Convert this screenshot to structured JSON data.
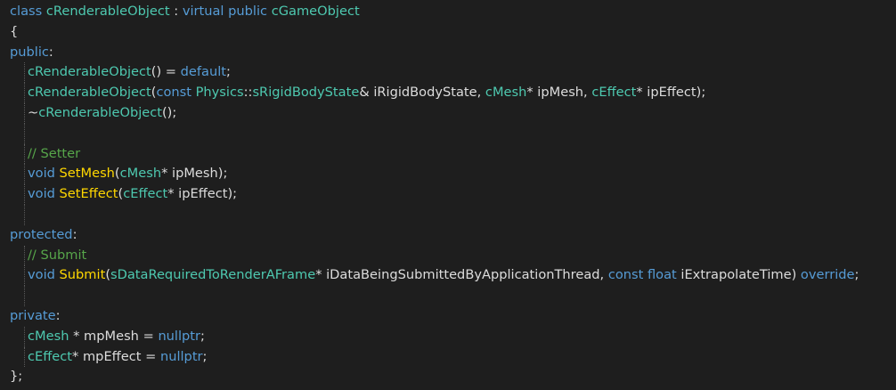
{
  "editor": {
    "colors": {
      "background": "#1e1e1e",
      "keyword": "#569cd6",
      "type": "#4ec9b0",
      "function": "#ffd700",
      "comment": "#57a64a",
      "text": "#dcdcdc"
    },
    "lines": [
      {
        "indent": false,
        "tokens": [
          {
            "t": "class ",
            "c": "kw"
          },
          {
            "t": "cRenderableObject",
            "c": "ty"
          },
          {
            "t": " : ",
            "c": "pl"
          },
          {
            "t": "virtual public ",
            "c": "kw"
          },
          {
            "t": "cGameObject",
            "c": "ty"
          }
        ]
      },
      {
        "indent": false,
        "tokens": [
          {
            "t": "{",
            "c": "pl"
          }
        ]
      },
      {
        "indent": false,
        "tokens": [
          {
            "t": "public",
            "c": "kw"
          },
          {
            "t": ":",
            "c": "pl"
          }
        ]
      },
      {
        "indent": true,
        "tokens": [
          {
            "t": "cRenderableObject",
            "c": "ty"
          },
          {
            "t": "() = ",
            "c": "pl"
          },
          {
            "t": "default",
            "c": "kw"
          },
          {
            "t": ";",
            "c": "pl"
          }
        ]
      },
      {
        "indent": true,
        "tokens": [
          {
            "t": "cRenderableObject",
            "c": "ty"
          },
          {
            "t": "(",
            "c": "pl"
          },
          {
            "t": "const ",
            "c": "kw"
          },
          {
            "t": "Physics",
            "c": "ty"
          },
          {
            "t": "::",
            "c": "pl"
          },
          {
            "t": "sRigidBodyState",
            "c": "ty"
          },
          {
            "t": "& iRigidBodyState, ",
            "c": "pl"
          },
          {
            "t": "cMesh",
            "c": "ty"
          },
          {
            "t": "* ipMesh, ",
            "c": "pl"
          },
          {
            "t": "cEffect",
            "c": "ty"
          },
          {
            "t": "* ipEffect);",
            "c": "pl"
          }
        ]
      },
      {
        "indent": true,
        "tokens": [
          {
            "t": "~",
            "c": "pl"
          },
          {
            "t": "cRenderableObject",
            "c": "ty"
          },
          {
            "t": "();",
            "c": "pl"
          }
        ]
      },
      {
        "indent": true,
        "tokens": []
      },
      {
        "indent": true,
        "tokens": [
          {
            "t": "// Setter",
            "c": "cm"
          }
        ]
      },
      {
        "indent": true,
        "tokens": [
          {
            "t": "void ",
            "c": "kw"
          },
          {
            "t": "SetMesh",
            "c": "fn"
          },
          {
            "t": "(",
            "c": "pl"
          },
          {
            "t": "cMesh",
            "c": "ty"
          },
          {
            "t": "* ipMesh);",
            "c": "pl"
          }
        ]
      },
      {
        "indent": true,
        "tokens": [
          {
            "t": "void ",
            "c": "kw"
          },
          {
            "t": "SetEffect",
            "c": "fn"
          },
          {
            "t": "(",
            "c": "pl"
          },
          {
            "t": "cEffect",
            "c": "ty"
          },
          {
            "t": "* ipEffect);",
            "c": "pl"
          }
        ]
      },
      {
        "indent": true,
        "tokens": []
      },
      {
        "indent": false,
        "tokens": [
          {
            "t": "protected",
            "c": "kw"
          },
          {
            "t": ":",
            "c": "pl"
          }
        ]
      },
      {
        "indent": true,
        "tokens": [
          {
            "t": "// Submit",
            "c": "cm"
          }
        ]
      },
      {
        "indent": true,
        "tokens": [
          {
            "t": "void ",
            "c": "kw"
          },
          {
            "t": "Submit",
            "c": "fn"
          },
          {
            "t": "(",
            "c": "pl"
          },
          {
            "t": "sDataRequiredToRenderAFrame",
            "c": "ty"
          },
          {
            "t": "* iDataBeingSubmittedByApplicationThread, ",
            "c": "pl"
          },
          {
            "t": "const float ",
            "c": "kw"
          },
          {
            "t": "iExtrapolateTime) ",
            "c": "pl"
          },
          {
            "t": "override",
            "c": "kw"
          },
          {
            "t": ";",
            "c": "pl"
          }
        ]
      },
      {
        "indent": true,
        "tokens": []
      },
      {
        "indent": false,
        "tokens": [
          {
            "t": "private",
            "c": "kw"
          },
          {
            "t": ":",
            "c": "pl"
          }
        ]
      },
      {
        "indent": true,
        "tokens": [
          {
            "t": "cMesh",
            "c": "ty"
          },
          {
            "t": " * mpMesh = ",
            "c": "pl"
          },
          {
            "t": "nullptr",
            "c": "kw"
          },
          {
            "t": ";",
            "c": "pl"
          }
        ]
      },
      {
        "indent": true,
        "tokens": [
          {
            "t": "cEffect",
            "c": "ty"
          },
          {
            "t": "* mpEffect = ",
            "c": "pl"
          },
          {
            "t": "nullptr",
            "c": "kw"
          },
          {
            "t": ";",
            "c": "pl"
          }
        ]
      },
      {
        "indent": false,
        "tokens": [
          {
            "t": "};",
            "c": "pl"
          }
        ]
      }
    ]
  }
}
